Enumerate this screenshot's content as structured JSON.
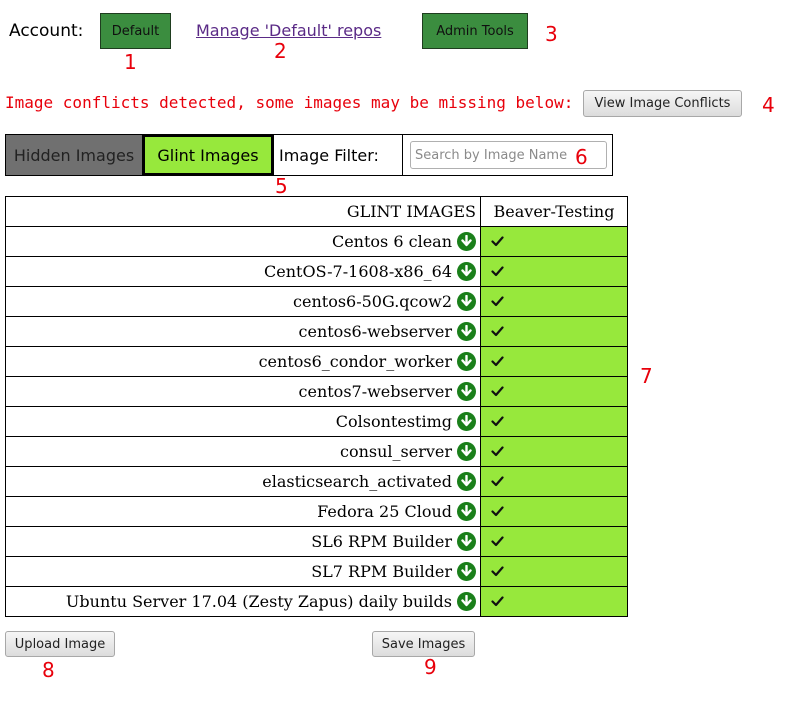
{
  "header": {
    "account_label": "Account:",
    "account_button": "Default",
    "manage_link": "Manage 'Default' repos",
    "admin_button": "Admin Tools"
  },
  "conflict": {
    "message": "Image conflicts detected, some images may be missing below:",
    "button": "View Image Conflicts"
  },
  "tabs": {
    "hidden": "Hidden Images",
    "glint": "Glint Images",
    "filter_label": "Image Filter:",
    "search_placeholder": "Search by Image Name"
  },
  "table": {
    "headers": [
      "GLINT IMAGES",
      "Beaver-Testing"
    ],
    "rows": [
      {
        "name": "Centos 6 clean",
        "checked": true
      },
      {
        "name": "CentOS-7-1608-x86_64",
        "checked": true
      },
      {
        "name": "centos6-50G.qcow2",
        "checked": true
      },
      {
        "name": "centos6-webserver",
        "checked": true
      },
      {
        "name": "centos6_condor_worker",
        "checked": true
      },
      {
        "name": "centos7-webserver",
        "checked": true
      },
      {
        "name": "Colsontestimg",
        "checked": true
      },
      {
        "name": "consul_server",
        "checked": true
      },
      {
        "name": "elasticsearch_activated",
        "checked": true
      },
      {
        "name": "Fedora 25 Cloud",
        "checked": true
      },
      {
        "name": "SL6 RPM Builder",
        "checked": true
      },
      {
        "name": "SL7 RPM Builder",
        "checked": true
      },
      {
        "name": "Ubuntu Server 17.04 (Zesty Zapus) daily builds",
        "checked": true
      }
    ],
    "check_glyph": "🗸",
    "download_icon": "download-arrow-icon"
  },
  "footer": {
    "upload_button": "Upload Image",
    "save_button": "Save Images"
  },
  "markers": {
    "m1": "1",
    "m2": "2",
    "m3": "3",
    "m4": "4",
    "m5": "5",
    "m6": "6",
    "m7": "7",
    "m8": "8",
    "m9": "9"
  },
  "colors": {
    "accent_green": "#97e83c",
    "button_green": "#3b8d3f",
    "warning_red": "#e8000b",
    "icon_green": "#1a7f1a"
  }
}
